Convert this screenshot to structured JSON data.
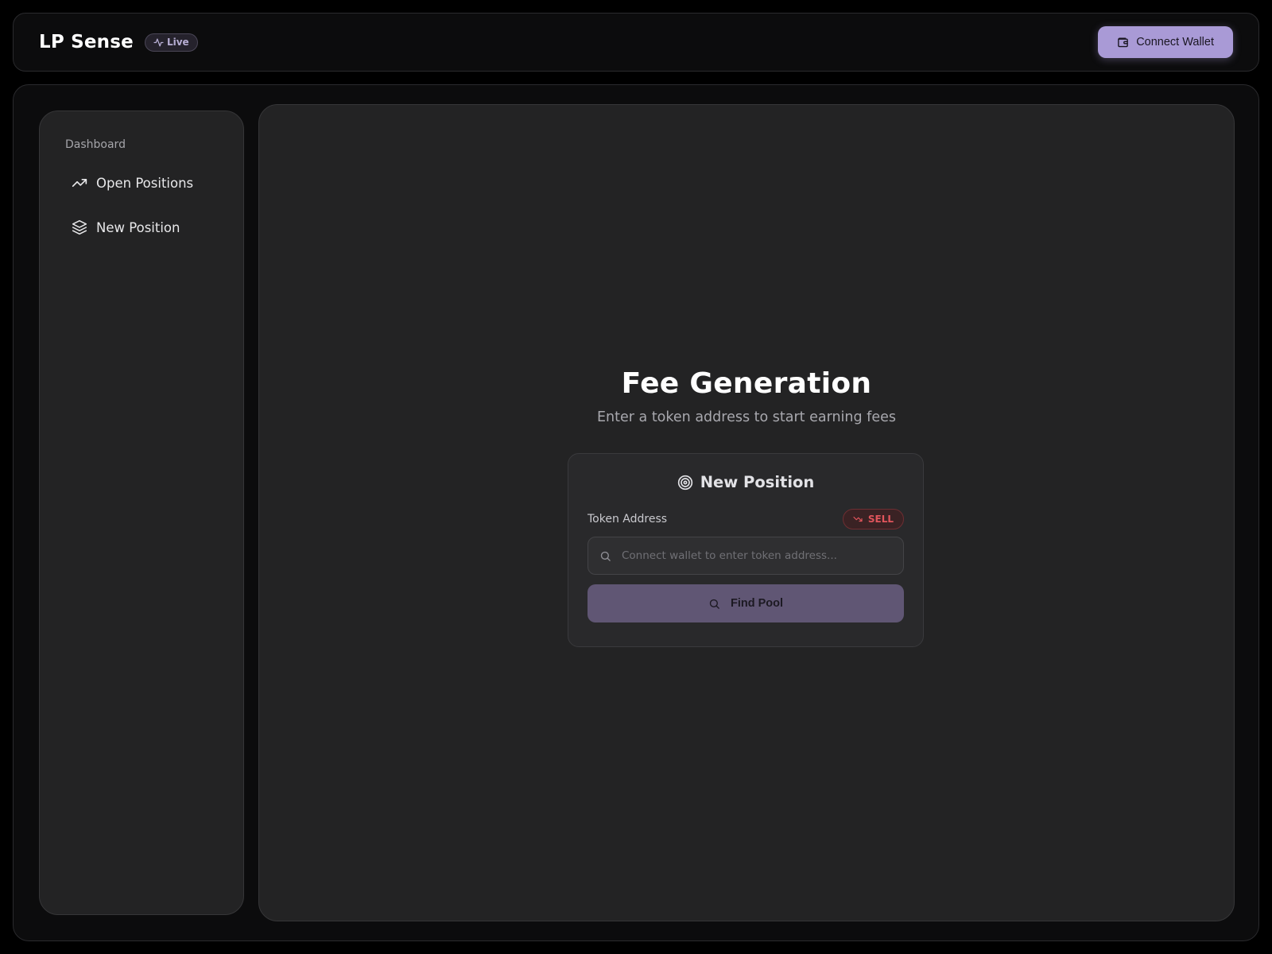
{
  "header": {
    "brand": "LP Sense",
    "live_badge": {
      "label": "Live",
      "icon": "activity-icon"
    },
    "connect_button": {
      "label": "Connect Wallet",
      "icon": "wallet-icon"
    }
  },
  "sidebar": {
    "heading": "Dashboard",
    "items": [
      {
        "label": "Open Positions",
        "icon": "trending-up-icon"
      },
      {
        "label": "New Position",
        "icon": "layers-icon"
      }
    ]
  },
  "main": {
    "title": "Fee Generation",
    "subtitle": "Enter a token address to start earning fees",
    "card": {
      "title": "New Position",
      "title_icon": "target-icon",
      "field_label": "Token Address",
      "direction_badge": {
        "label": "SELL",
        "icon": "trending-down-icon",
        "color": "#e0555c"
      },
      "token_input": {
        "value": "",
        "placeholder": "Connect wallet to enter token address..."
      },
      "find_button": {
        "label": "Find Pool",
        "icon": "search-icon"
      }
    }
  },
  "colors": {
    "accent": "#a99ad6",
    "accent_muted": "#605674",
    "danger": "#e0555c",
    "background": "#000000",
    "panel": "#232324"
  }
}
